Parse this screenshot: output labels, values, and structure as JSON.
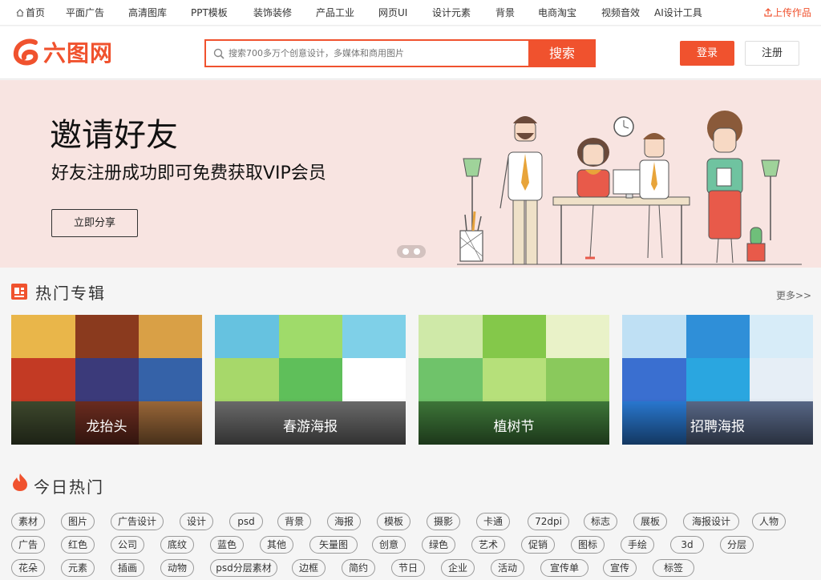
{
  "topnav": {
    "items": [
      "首页",
      "平面广告",
      "高清图库",
      "PPT模板",
      "装饰装修",
      "产品工业",
      "网页UI",
      "设计元素",
      "背景",
      "电商淘宝",
      "视频音效",
      "AI设计工具"
    ],
    "upload": "上传作品"
  },
  "header": {
    "logo_text": "六图网",
    "search_placeholder": "搜索700多万个创意设计，多媒体和商用图片",
    "search_button": "搜索",
    "login": "登录",
    "register": "注册"
  },
  "banner": {
    "title": "邀请好友",
    "subtitle": "好友注册成功即可免费获取VIP会员",
    "button": "立即分享"
  },
  "albums": {
    "title": "热门专辑",
    "more": "更多>>",
    "cards": [
      {
        "label": "龙抬头"
      },
      {
        "label": "春游海报"
      },
      {
        "label": "植树节"
      },
      {
        "label": "招聘海报"
      }
    ]
  },
  "hot": {
    "title": "今日热门",
    "tags": [
      [
        "素材",
        "图片",
        "广告设计",
        "设计",
        "psd",
        "背景",
        "海报",
        "模板",
        "摄影",
        "卡通",
        "72dpi",
        "标志",
        "展板",
        "海报设计",
        "人物"
      ],
      [
        "广告",
        "红色",
        "公司",
        "底纹",
        "蓝色",
        "其他",
        "矢量图",
        "创意",
        "绿色",
        "艺术",
        "促销",
        "图标",
        "手绘",
        "3d",
        "分层"
      ],
      [
        "花朵",
        "元素",
        "插画",
        "动物",
        "psd分层素材",
        "边框",
        "简约",
        "节日",
        "企业",
        "活动",
        "宣传单",
        "宣传",
        "标签"
      ]
    ]
  },
  "colors": {
    "accent": "#f0522e",
    "banner_bg": "#f8e4e1"
  }
}
